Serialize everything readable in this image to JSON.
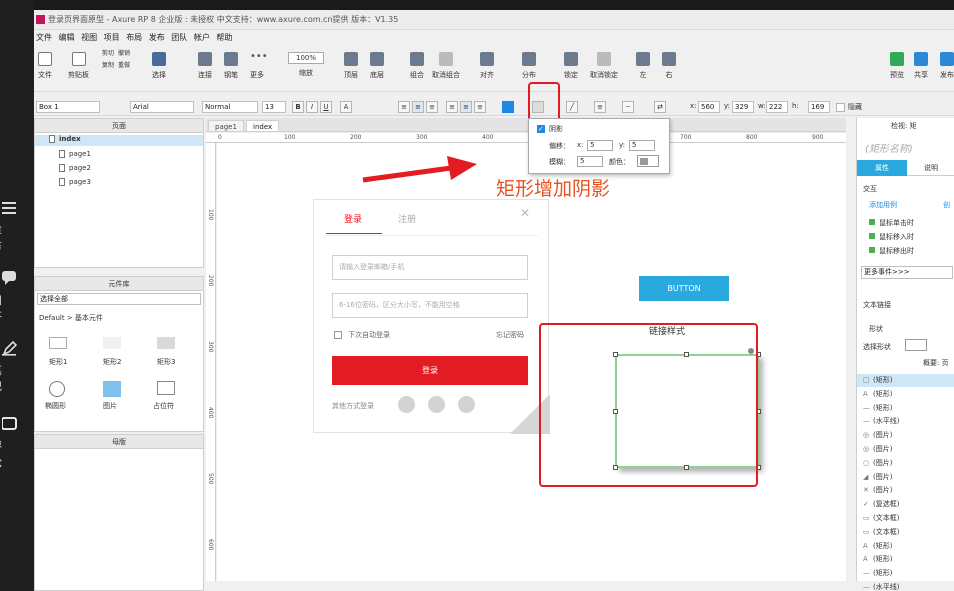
{
  "course_sidebar": {
    "items": [
      {
        "label": "章节",
        "icon": "list-icon"
      },
      {
        "label": "问答",
        "icon": "chat-icon"
      },
      {
        "label": "笔记",
        "icon": "pen-icon"
      },
      {
        "label": "评论",
        "icon": "comment-icon"
      }
    ]
  },
  "window": {
    "title": "登录页界面原型 - Axure RP 8 企业版 : 未授权 中文支持：www.axure.com.cn提供 版本：V1.35"
  },
  "menu": [
    "文件",
    "编辑",
    "视图",
    "项目",
    "布局",
    "发布",
    "团队",
    "帐户",
    "帮助"
  ],
  "toolbar": {
    "file": "文件",
    "clipboard": "剪贴板",
    "cut": "剪切",
    "copy": "复制",
    "undo": "撤销",
    "redo": "重做",
    "select": "选择",
    "connect": "连接",
    "pen": "钢笔",
    "more": "更多",
    "zoom_value": "100%",
    "zoom": "缩放",
    "top": "顶层",
    "bottom": "底层",
    "group": "组合",
    "ungroup": "取消组合",
    "align": "对齐",
    "distribute": "分布",
    "lock": "锁定",
    "unlock": "取消锁定",
    "left": "左",
    "right": "右",
    "preview": "预览",
    "share": "共享",
    "publish": "发布"
  },
  "formatbar": {
    "widget_name": "Box 1",
    "font": "Arial",
    "style": "Normal",
    "size": "13",
    "x_label": "x:",
    "x_value": "560",
    "y_label": "y:",
    "y_value": "329",
    "w_label": "w:",
    "w_value": "222",
    "h_label": "h:",
    "h_value": "169",
    "hidden": "隐藏"
  },
  "pages_panel": {
    "title": "页面",
    "root": "index",
    "pages": [
      "page1",
      "page2",
      "page3"
    ]
  },
  "widgets_panel": {
    "title": "元件库",
    "select_all": "选择全部",
    "library": "Default > 基本元件",
    "items": [
      "矩形1",
      "矩形2",
      "矩形3",
      "椭圆形",
      "图片",
      "占位符"
    ]
  },
  "masters_panel": {
    "title": "母版"
  },
  "tabs": [
    "page1",
    "index"
  ],
  "ruler": {
    "h": [
      "0",
      "100",
      "200",
      "300",
      "400",
      "500",
      "600",
      "700",
      "800",
      "900"
    ],
    "v": [
      "100",
      "200",
      "300",
      "400",
      "500",
      "600"
    ]
  },
  "login_mock": {
    "tab_login": "登录",
    "tab_register": "注册",
    "close": "✕",
    "input1_placeholder": "请输入登录邮箱/手机",
    "input2_placeholder": "6-16位密码，区分大小写，不能用空格",
    "remember": "下次自动登录",
    "forgot": "忘记密码",
    "submit": "登录",
    "other": "其他方式登录"
  },
  "button_widget": {
    "label": "BUTTON"
  },
  "link_style_label": "链接样式",
  "annotation": {
    "text": "矩形增加阴影",
    "color": "#e8501e"
  },
  "shadow_popup": {
    "title": "阴影",
    "offset": "偏移：",
    "x_label": "x:",
    "x_value": "5",
    "y_label": "y:",
    "y_value": "5",
    "blur": "模糊：",
    "blur_value": "5",
    "color": "颜色："
  },
  "right_panel": {
    "tab_inspect": "检视: 矩",
    "name_placeholder": "(矩形名称)",
    "tab_props": "属性",
    "tab_notes": "说明",
    "interaction": "交互",
    "add_case": "添加用例",
    "create_link": "创",
    "events": [
      "鼠标单击时",
      "鼠标移入时",
      "鼠标移出时"
    ],
    "more_events": "更多事件>>>",
    "text_link": "文本链接",
    "shape": "形状",
    "select_shape": "选择形状",
    "outline_title": "概要: 页",
    "outline": [
      {
        "sym": "□",
        "label": "(矩形)"
      },
      {
        "sym": "A",
        "label": "(矩形)"
      },
      {
        "sym": "—",
        "label": "(矩形)"
      },
      {
        "sym": "—",
        "label": "(水平线)"
      },
      {
        "sym": "◎",
        "label": "(图片)"
      },
      {
        "sym": "◎",
        "label": "(图片)"
      },
      {
        "sym": "○",
        "label": "(图片)"
      },
      {
        "sym": "◢",
        "label": "(图片)"
      },
      {
        "sym": "✕",
        "label": "(图片)"
      },
      {
        "sym": "✓",
        "label": "(复选框)"
      },
      {
        "sym": "▭",
        "label": "(文本框)"
      },
      {
        "sym": "▭",
        "label": "(文本框)"
      },
      {
        "sym": "A",
        "label": "(矩形)"
      },
      {
        "sym": "A",
        "label": "(矩形)"
      },
      {
        "sym": "—",
        "label": "(矩形)"
      },
      {
        "sym": "—",
        "label": "(水平线)"
      }
    ]
  },
  "colors": {
    "accent_red": "#e31b23",
    "button_blue": "#29a9e0",
    "selection_green": "#8fd18f",
    "tab_blue": "#29a9e0"
  }
}
